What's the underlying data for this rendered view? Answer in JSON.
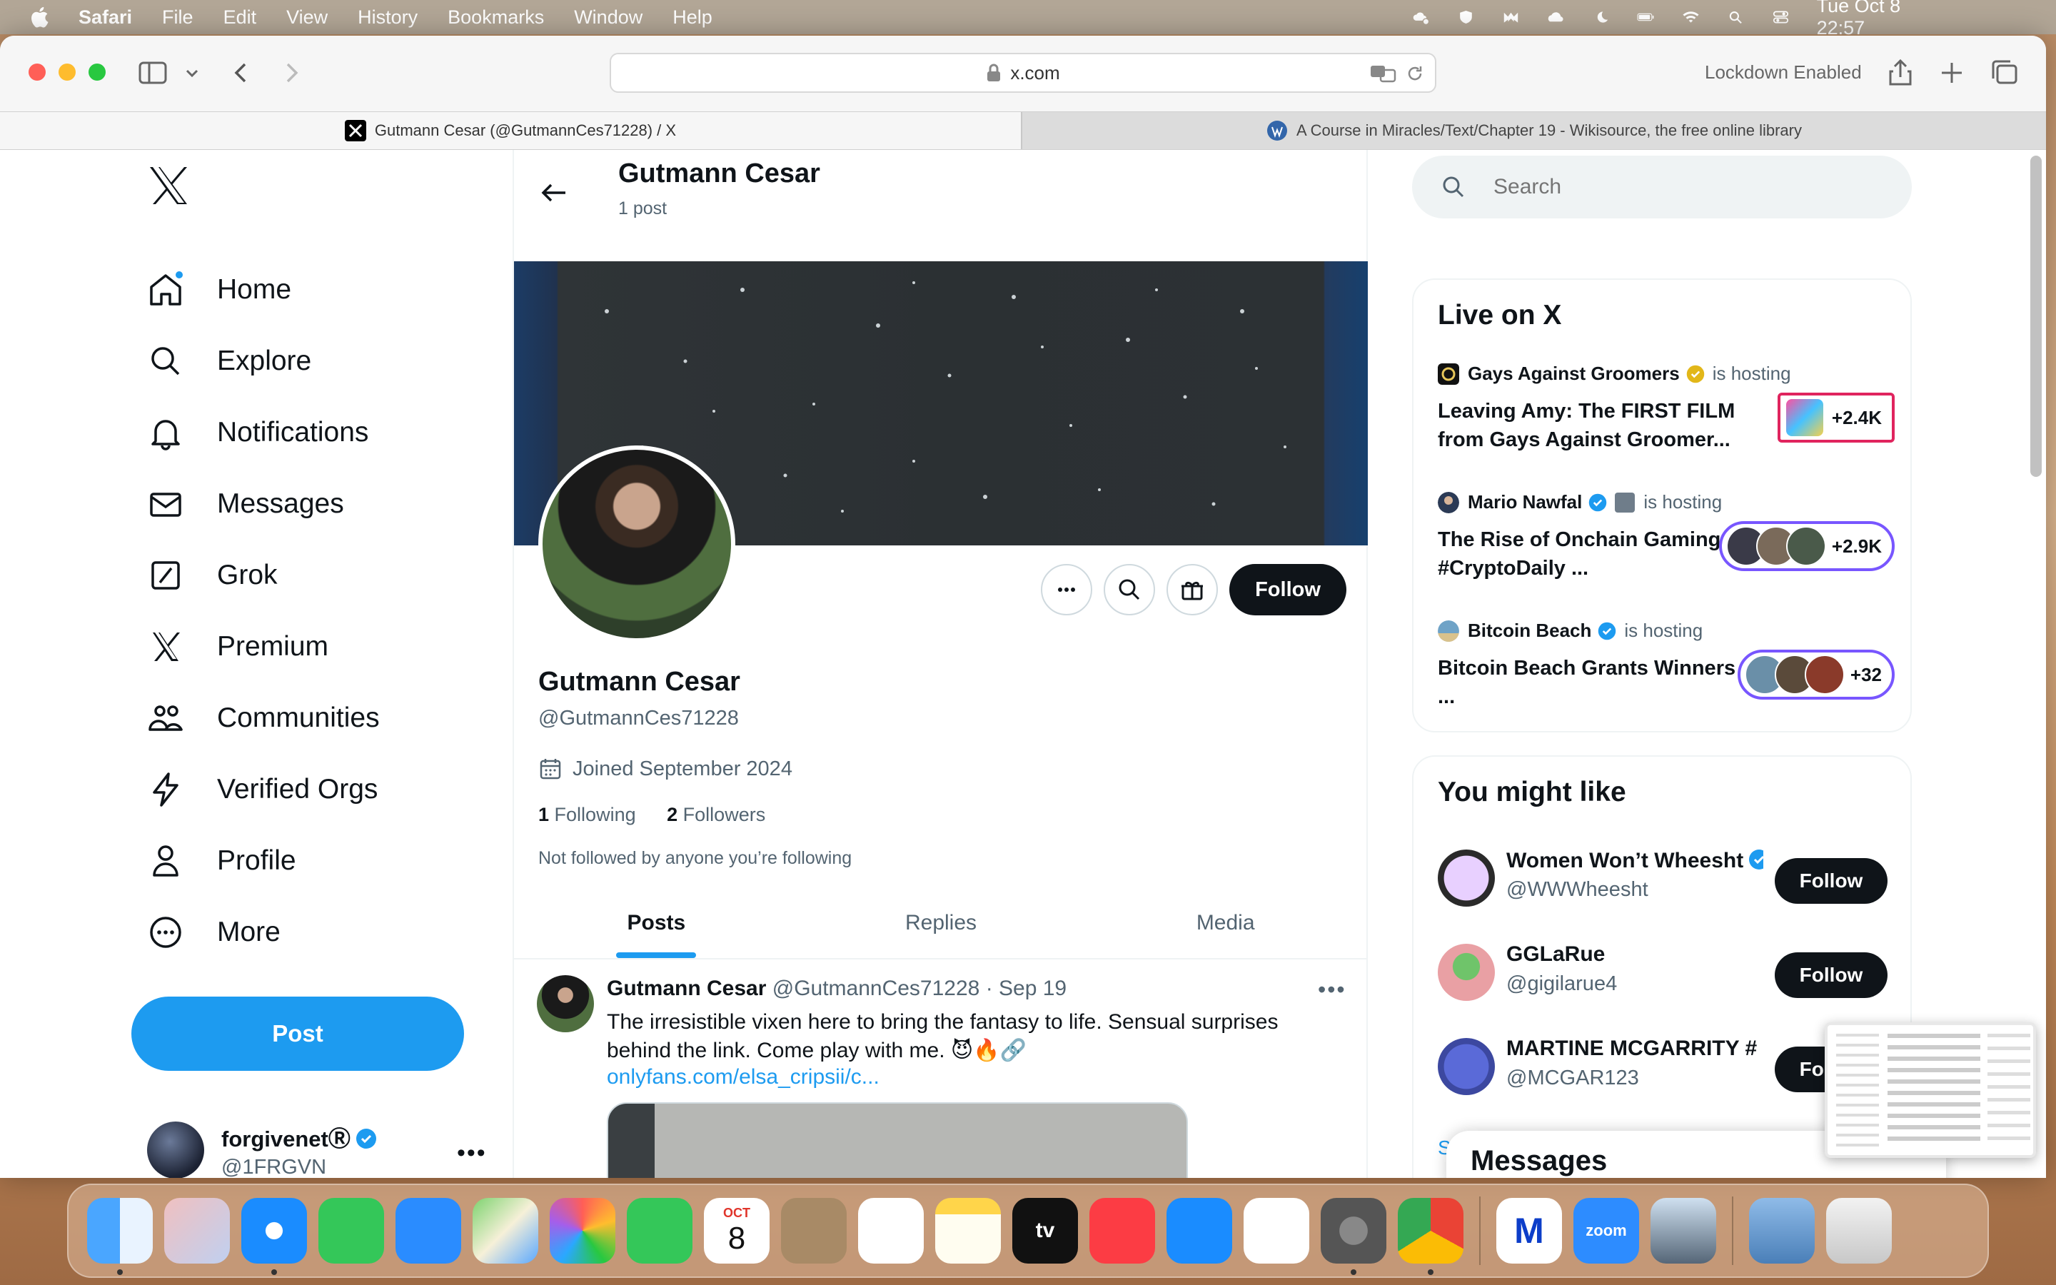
{
  "menubar": {
    "app": "Safari",
    "items": [
      "File",
      "Edit",
      "View",
      "History",
      "Bookmarks",
      "Window",
      "Help"
    ],
    "clock": "Tue Oct 8  22:57"
  },
  "browser": {
    "url": "x.com",
    "lockdown": "Lockdown Enabled",
    "tabs": [
      {
        "title": "Gutmann Cesar (@GutmannCes71228) / X"
      },
      {
        "title": "A Course in Miracles/Text/Chapter 19 - Wikisource, the free online library"
      }
    ]
  },
  "nav": {
    "items": [
      {
        "label": "Home",
        "icon": "home-icon"
      },
      {
        "label": "Explore",
        "icon": "search-icon"
      },
      {
        "label": "Notifications",
        "icon": "bell-icon"
      },
      {
        "label": "Messages",
        "icon": "envelope-icon"
      },
      {
        "label": "Grok",
        "icon": "grok-icon"
      },
      {
        "label": "Premium",
        "icon": "x-icon"
      },
      {
        "label": "Communities",
        "icon": "people-icon"
      },
      {
        "label": "Verified Orgs",
        "icon": "lightning-icon"
      },
      {
        "label": "Profile",
        "icon": "person-icon"
      },
      {
        "label": "More",
        "icon": "more-circle-icon"
      }
    ],
    "post_label": "Post",
    "account": {
      "name": "forgivenetⓇ",
      "handle": "@1FRGVN"
    }
  },
  "profile": {
    "header_title": "Gutmann Cesar",
    "header_sub": "1 post",
    "name": "Gutmann Cesar",
    "handle": "@GutmannCes71228",
    "joined": "Joined September 2024",
    "following_count": "1",
    "following_label": "Following",
    "followers_count": "2",
    "followers_label": "Followers",
    "not_followed": "Not followed by anyone you’re following",
    "follow_label": "Follow",
    "tabs": [
      "Posts",
      "Replies",
      "Media"
    ]
  },
  "tweet": {
    "name": "Gutmann Cesar",
    "handle_date": "@GutmannCes71228 · Sep 19",
    "text": "The irresistible vixen here to bring the fantasy to life. Sensual surprises behind the link.  Come play with me.  😈🔥🔗",
    "link": "onlyfans.com/elsa_cripsii/c..."
  },
  "search": {
    "placeholder": "Search"
  },
  "live": {
    "title": "Live on X",
    "items": [
      {
        "host": "Gays Against Groomers",
        "status": "is hosting",
        "title": "Leaving Amy: The FIRST FILM from Gays Against Groomer...",
        "count": "+2.4K"
      },
      {
        "host": "Mario Nawfal",
        "status": "is hosting",
        "title": "The Rise of Onchain Gaming #CryptoDaily ...",
        "count": "+2.9K"
      },
      {
        "host": "Bitcoin Beach",
        "status": "is hosting",
        "title": "Bitcoin Beach Grants Winners - ...",
        "count": "+32"
      }
    ]
  },
  "might_like": {
    "title": "You might like",
    "items": [
      {
        "name": "Women Won’t Wheesht",
        "handle": "@WWWheesht",
        "follow": "Follow"
      },
      {
        "name": "GGLaRue",
        "handle": "@gigilarue4",
        "follow": "Follow"
      },
      {
        "name": "MARTINE MCGARRITY #",
        "handle": "@MCGAR123",
        "follow": "Follow"
      }
    ],
    "show_more": "Sh"
  },
  "messages_drawer": {
    "title": "Messages"
  },
  "dock": {
    "calendar_month": "OCT",
    "calendar_day": "8",
    "zoom_label": "zoom",
    "tv_label": "tv"
  },
  "colors": {
    "accent": "#1d9bf0",
    "text": "#0f1419",
    "muted": "#536471",
    "live_ring": "#7856ff"
  }
}
